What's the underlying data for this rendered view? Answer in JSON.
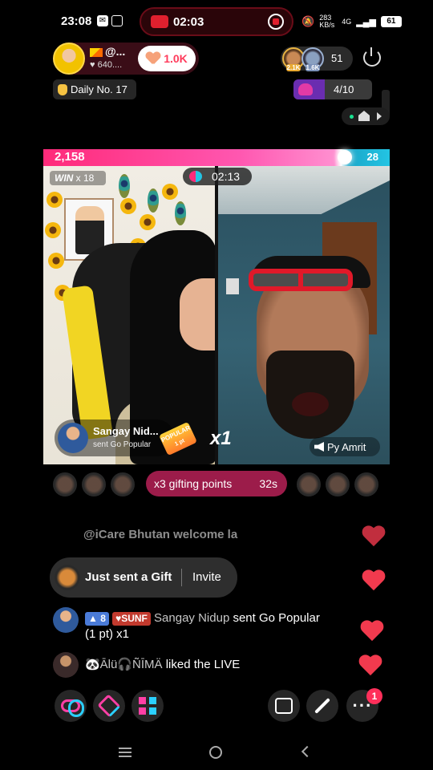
{
  "status_bar": {
    "time": "23:08",
    "recording_time": "02:03",
    "network_speed": "283 KB/s",
    "network_type": "4G",
    "battery": "61"
  },
  "host": {
    "name": "@...",
    "likes": "640....",
    "follow_count": "1.0K"
  },
  "viewers": {
    "badge_1": "2.1K",
    "badge_2": "1.6K",
    "count": "51"
  },
  "daily": {
    "label": "Daily No. 17"
  },
  "goal": {
    "progress": "4/10",
    "fraction": 0.4
  },
  "battle": {
    "left_score": "2,158",
    "right_score": "28",
    "left_share": 0.87,
    "timer": "02:13",
    "win_label": "WIN",
    "win_mult": "x 18"
  },
  "gift_popup": {
    "name": "Sangay Nid...",
    "action": "sent Go Popular",
    "tag": "POPULAR",
    "tag_sub": "1 pt",
    "multiplier": "x1"
  },
  "opponent": {
    "name": "Py Amrit"
  },
  "gift_banner": {
    "label": "x3 gifting points",
    "countdown": "32s"
  },
  "chat": {
    "faded_line": "@iCare Bhutan welcome la",
    "sent_gift": {
      "text": "Just sent a Gift",
      "invite": "Invite"
    },
    "messages": [
      {
        "level": "8",
        "fan_badge": "SUNF",
        "user": "Sangay Nidup",
        "text": "sent Go Popular",
        "text2": "(1 pt) x1"
      },
      {
        "user": "🐼Ālü🎧ÑĪMÄ",
        "text": "liked the LIVE"
      }
    ]
  },
  "bottom_bar": {
    "more_badge": "1"
  },
  "colors": {
    "accent_pink": "#ff2a7a",
    "accent_cyan": "#23c4e3",
    "gift_banner": "#9c1c4a",
    "heart": "#f23a4e"
  },
  "icons": [
    "record-icon",
    "heart-icon",
    "power-icon",
    "hand-icon",
    "goal-icon",
    "home-icon",
    "speaker-icon",
    "co-host-icon",
    "gift-icon",
    "apps-icon",
    "share-icon",
    "magic-wand-icon",
    "more-icon"
  ]
}
